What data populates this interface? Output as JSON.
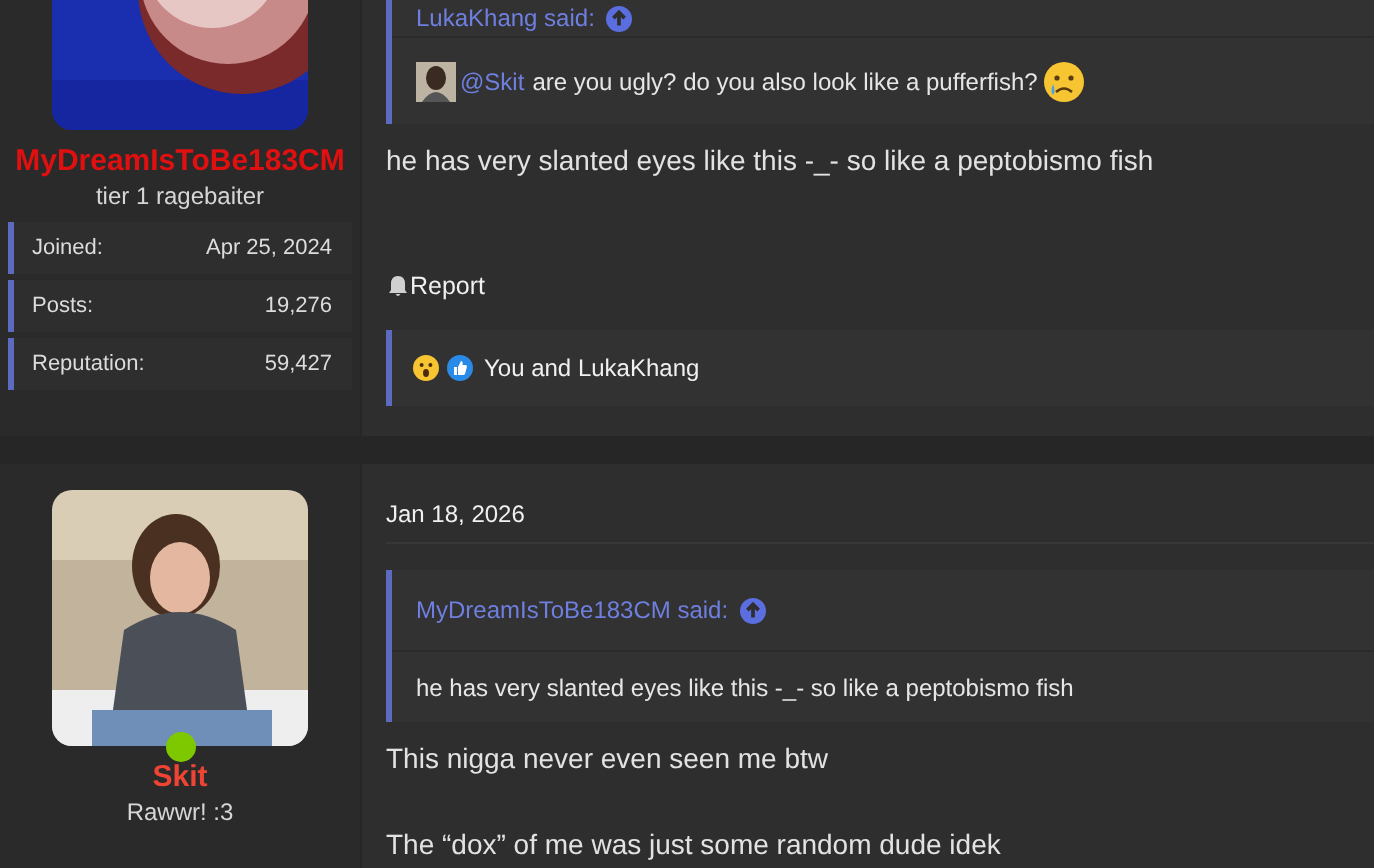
{
  "posts": [
    {
      "author": {
        "name": "MyDreamIsToBe183CM",
        "color": "#e01010",
        "title": "tier 1 ragebaiter",
        "stats": [
          {
            "label": "Joined:",
            "value": "Apr 25, 2024"
          },
          {
            "label": "Posts:",
            "value": "19,276"
          },
          {
            "label": "Reputation:",
            "value": "59,427"
          }
        ]
      },
      "quote": {
        "author": "LukaKhang said:",
        "mention": "@Skit",
        "text": "are you ugly? do you also look like a pufferfish?"
      },
      "body": [
        "he has very slanted eyes like this -_- so like a peptobismo fish"
      ],
      "report": "Report",
      "reactions": "You and LukaKhang"
    },
    {
      "author": {
        "name": "Skit",
        "color": "#ee4433",
        "title": "Rawwr! :3",
        "online": true
      },
      "date": "Jan 18, 2026",
      "quote": {
        "author": "MyDreamIsToBe183CM said:",
        "text": "he has very slanted eyes like this -_- so like a peptobismo fish"
      },
      "body": [
        "This nigga never even seen me btw",
        "The “dox” of me was just some random dude idek"
      ]
    }
  ]
}
